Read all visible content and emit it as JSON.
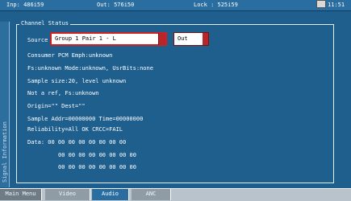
{
  "status_bar": {
    "input": "Inp: 486i59",
    "output": "Out: 576i50",
    "lock": "Lock : 525i59",
    "time": "11:51"
  },
  "side_tab": {
    "label": "Signal Information"
  },
  "panel": {
    "title": "Channel Status",
    "source_label": "Source",
    "source_value": "Group 1 Pair 1 - L",
    "out_value": "Out",
    "lines": {
      "consumer": "Consumer PCM Emph:unknown",
      "fs": "Fs:unknown Mode:unknown, UsrBits:none",
      "sample_size": "Sample size:20, level unknown",
      "not_ref": "Not a ref, Fs:unknown",
      "origin": "Origin=\"\" Dest=\"\"",
      "sample_addr": "Sample Addr=00000000 Time=00000000",
      "reliability": "Reliability=All OK   CRCC=FAIL",
      "data_1": "Data:  00 00 00 00 00 00 00 00",
      "data_2": "00 00 00 00 00 00 00 00",
      "data_3": "00 00 00 00 00 00 00 00"
    }
  },
  "tabs": [
    {
      "label": "Main Menu"
    },
    {
      "label": "Video"
    },
    {
      "label": "Audio"
    },
    {
      "label": "ANC"
    }
  ]
}
